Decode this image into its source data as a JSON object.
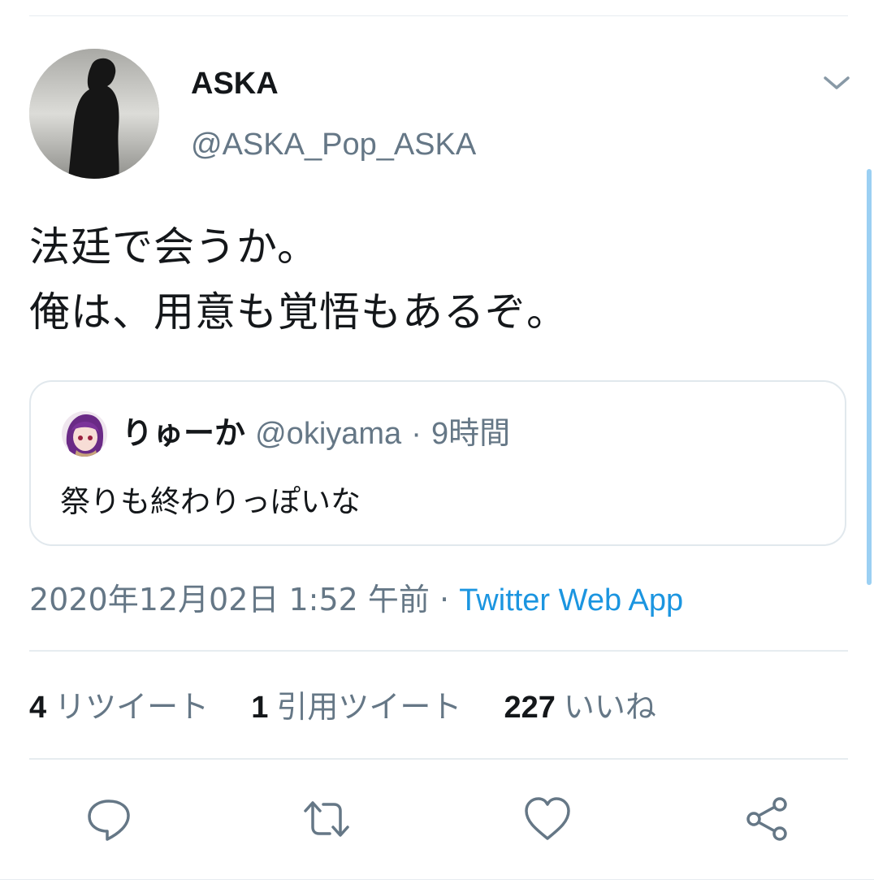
{
  "colors": {
    "text_primary": "#14171a",
    "text_secondary": "#657786",
    "link": "#1b95e0",
    "border": "#e1e8ed"
  },
  "tweet": {
    "author": {
      "display_name": "ASKA",
      "handle": "@ASKA_Pop_ASKA",
      "avatar_icon": "avatar-silhouette"
    },
    "text_lines": [
      "法廷で会うか。",
      "俺は、用意も覚悟もあるぞ。"
    ],
    "quoted_tweet": {
      "display_name": "りゅーか",
      "handle": "@okiyama",
      "separator": "·",
      "time": "9時間",
      "text": "祭りも終わりっぽいな"
    },
    "timestamp": "2020年12月02日 1:52 午前",
    "separator": "·",
    "source": "Twitter Web App",
    "stats": {
      "retweets": {
        "count": "4",
        "label": "リツイート"
      },
      "quote_tweets": {
        "count": "1",
        "label": "引用ツイート"
      },
      "likes": {
        "count": "227",
        "label": "いいね"
      }
    }
  },
  "actions": [
    {
      "name": "reply",
      "icon": "reply-icon"
    },
    {
      "name": "retweet",
      "icon": "retweet-icon"
    },
    {
      "name": "like",
      "icon": "heart-icon"
    },
    {
      "name": "share",
      "icon": "share-icon"
    }
  ],
  "menu": {
    "icon": "chevron-down-icon"
  }
}
